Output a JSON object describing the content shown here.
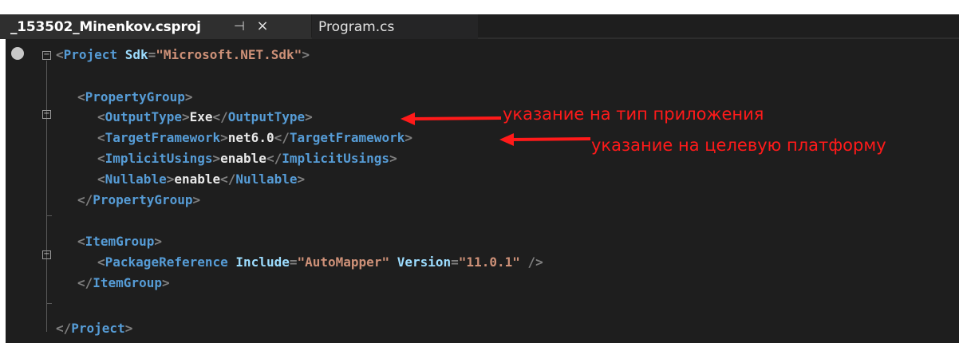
{
  "tabs": [
    {
      "label": "_153502_Minenkov.csproj",
      "active": true
    },
    {
      "label": "Program.cs",
      "active": false
    }
  ],
  "tab_pin_glyph": "⊣",
  "tab_close_glyph": "×",
  "code": {
    "line1": {
      "p1": "<",
      "t1": "Project",
      "a1": "Sdk",
      "eq": "=",
      "q1": "\"",
      "v1": "Microsoft.NET.Sdk",
      "q2": "\"",
      "p2": ">"
    },
    "line3": {
      "p1": "<",
      "t1": "PropertyGroup",
      "p2": ">"
    },
    "line4": {
      "p1": "<",
      "t1": "OutputType",
      "p2": ">",
      "x": "Exe",
      "p3": "</",
      "t2": "OutputType",
      "p4": ">"
    },
    "line5": {
      "p1": "<",
      "t1": "TargetFramework",
      "p2": ">",
      "x": "net6.0",
      "p3": "</",
      "t2": "TargetFramework",
      "p4": ">"
    },
    "line6": {
      "p1": "<",
      "t1": "ImplicitUsings",
      "p2": ">",
      "x": "enable",
      "p3": "</",
      "t2": "ImplicitUsings",
      "p4": ">"
    },
    "line7": {
      "p1": "<",
      "t1": "Nullable",
      "p2": ">",
      "x": "enable",
      "p3": "</",
      "t2": "Nullable",
      "p4": ">"
    },
    "line8": {
      "p1": "</",
      "t1": "PropertyGroup",
      "p2": ">"
    },
    "line10": {
      "p1": "<",
      "t1": "ItemGroup",
      "p2": ">"
    },
    "line11": {
      "p1": "<",
      "t1": "PackageReference",
      "a1": "Include",
      "eq1": "=",
      "v1": "\"AutoMapper\"",
      "a2": "Version",
      "eq2": "=",
      "v2": "\"11.0.1\"",
      "p2": "/>"
    },
    "line12": {
      "p1": "</",
      "t1": "ItemGroup",
      "p2": ">"
    },
    "line14": {
      "p1": "</",
      "t1": "Project",
      "p2": ">"
    }
  },
  "annotations": {
    "output_type": "указание на тип приложения",
    "target_framework": "указание на целевую платформу"
  },
  "colors": {
    "background": "#1e1e1e",
    "tag": "#569cd6",
    "attribute": "#9cdcfe",
    "string": "#ce9178",
    "punctuation": "#808080",
    "annotation": "#ff1a1a"
  }
}
